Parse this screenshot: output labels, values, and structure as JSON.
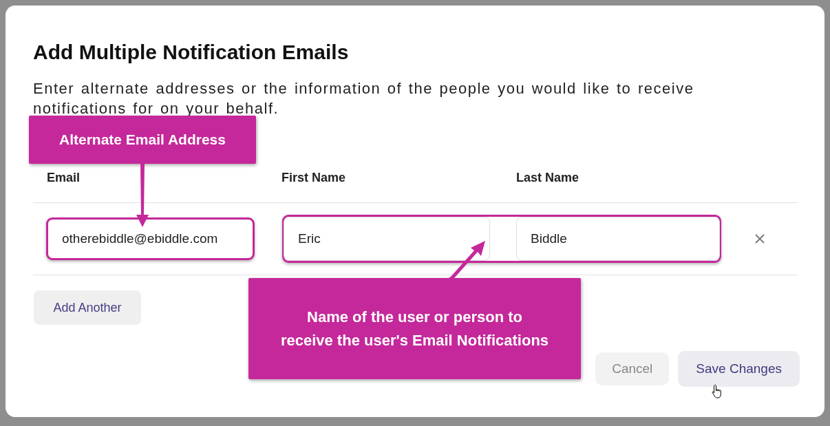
{
  "dialog": {
    "title": "Add Multiple Notification Emails",
    "description": "Enter alternate addresses or the information of the people you would like to receive notifications for on your behalf.",
    "columns": [
      "Email",
      "First Name",
      "Last Name"
    ],
    "rows": [
      {
        "email": "otherebiddle@ebiddle.com",
        "first_name": "Eric",
        "last_name": "Biddle"
      }
    ],
    "add_button": "Add Another",
    "buttons": [
      {
        "label": "Cancel",
        "disabled": true
      },
      {
        "label": "Save Changes",
        "disabled": false
      }
    ]
  },
  "annotations": [
    {
      "text": "Alternate Email Address"
    },
    {
      "text": "Name of the user or person to receive the user's Email Notifications"
    }
  ]
}
